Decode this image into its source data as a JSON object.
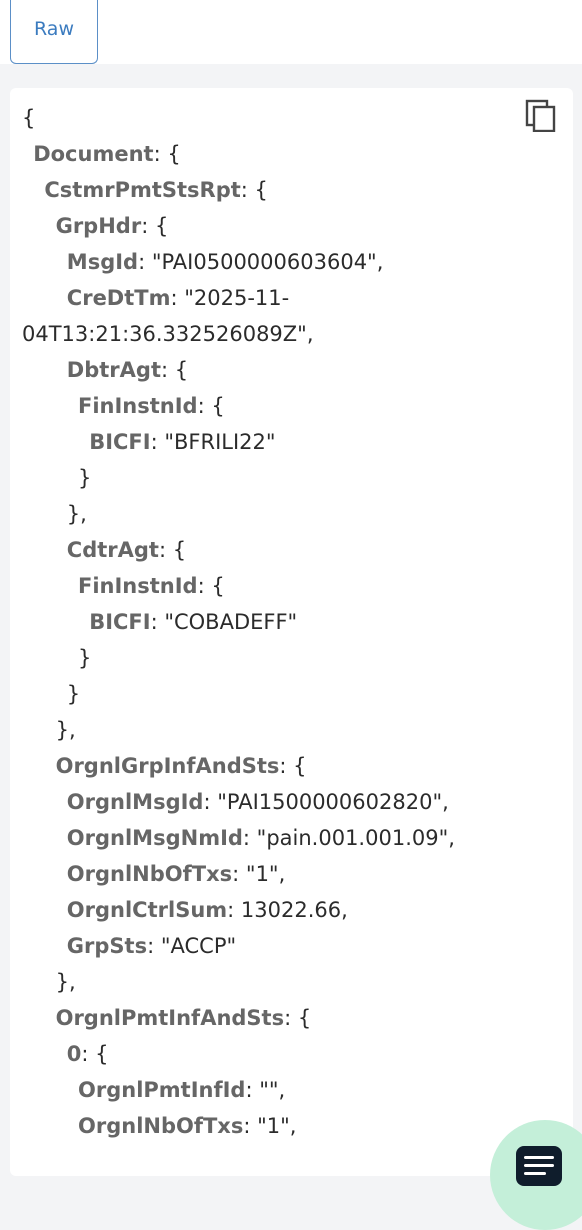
{
  "tabs": {
    "raw": "Raw"
  },
  "icons": {
    "copy": "copy-icon",
    "fab": "menu-lines-icon"
  },
  "colors": {
    "accent": "#3b7bbf",
    "fab_bg": "#c4efd9",
    "fab_icon_bg": "#0f1d2c",
    "key": "#666666"
  },
  "json_lines": [
    {
      "key": "",
      "text": "{",
      "indent": 0
    },
    {
      "key": "Document",
      "text": ": {",
      "indent": 1
    },
    {
      "key": "CstmrPmtStsRpt",
      "text": ": {",
      "indent": 2
    },
    {
      "key": "GrpHdr",
      "text": ": {",
      "indent": 3
    },
    {
      "key": "MsgId",
      "text": ": \"PAI0500000603604\",",
      "indent": 4
    },
    {
      "key": "CreDtTm",
      "text": ": \"2025-11-",
      "indent": 4
    },
    {
      "key": "",
      "text": "04T13:21:36.332526089Z\",",
      "indent": 0
    },
    {
      "key": "DbtrAgt",
      "text": ": {",
      "indent": 4
    },
    {
      "key": "FinInstnId",
      "text": ": {",
      "indent": 5
    },
    {
      "key": "BICFI",
      "text": ": \"BFRILI22\"",
      "indent": 6
    },
    {
      "key": "",
      "text": "}",
      "indent": 5
    },
    {
      "key": "",
      "text": "},",
      "indent": 4
    },
    {
      "key": "CdtrAgt",
      "text": ": {",
      "indent": 4
    },
    {
      "key": "FinInstnId",
      "text": ": {",
      "indent": 5
    },
    {
      "key": "BICFI",
      "text": ": \"COBADEFF\"",
      "indent": 6
    },
    {
      "key": "",
      "text": "}",
      "indent": 5
    },
    {
      "key": "",
      "text": "}",
      "indent": 4
    },
    {
      "key": "",
      "text": "},",
      "indent": 3
    },
    {
      "key": "OrgnlGrpInfAndSts",
      "text": ": {",
      "indent": 3
    },
    {
      "key": "OrgnlMsgId",
      "text": ": \"PAI1500000602820\",",
      "indent": 4
    },
    {
      "key": "OrgnlMsgNmId",
      "text": ": \"pain.001.001.09\",",
      "indent": 4
    },
    {
      "key": "OrgnlNbOfTxs",
      "text": ": \"1\",",
      "indent": 4
    },
    {
      "key": "OrgnlCtrlSum",
      "text": ": 13022.66,",
      "indent": 4
    },
    {
      "key": "GrpSts",
      "text": ": \"ACCP\"",
      "indent": 4
    },
    {
      "key": "",
      "text": "},",
      "indent": 3
    },
    {
      "key": "OrgnlPmtInfAndSts",
      "text": ": {",
      "indent": 3
    },
    {
      "key": "0",
      "text": ": {",
      "indent": 4
    },
    {
      "key": "OrgnlPmtInfId",
      "text": ": \"\",",
      "indent": 5
    },
    {
      "key": "OrgnlNbOfTxs",
      "text": ": \"1\",",
      "indent": 5
    }
  ]
}
